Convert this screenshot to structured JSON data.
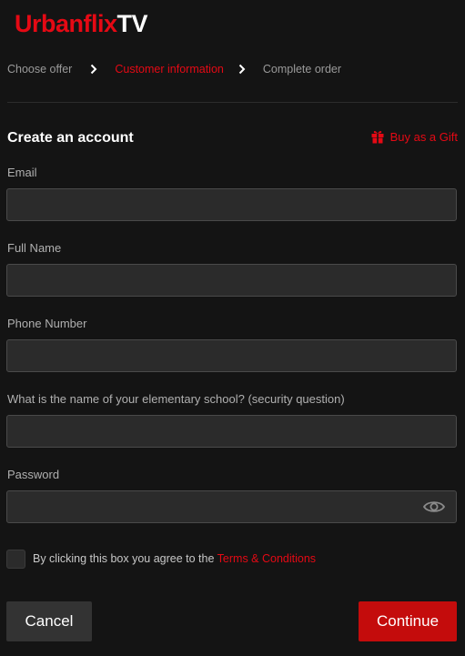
{
  "logo": {
    "brand": "Urbanflix",
    "suffix": "TV"
  },
  "steps": [
    {
      "label": "Choose offer",
      "active": false
    },
    {
      "label": "Customer information",
      "active": true
    },
    {
      "label": "Complete order",
      "active": false
    }
  ],
  "form": {
    "title": "Create an account",
    "gift_label": "Buy as a Gift",
    "fields": {
      "email": {
        "label": "Email",
        "value": "",
        "placeholder": ""
      },
      "full_name": {
        "label": "Full Name",
        "value": "",
        "placeholder": ""
      },
      "phone": {
        "label": "Phone Number",
        "value": "",
        "placeholder": ""
      },
      "security": {
        "label": "What is the name of your elementary school? (security question)",
        "value": "",
        "placeholder": ""
      },
      "password": {
        "label": "Password",
        "value": "",
        "placeholder": ""
      }
    },
    "agree_text": "By clicking this box you agree to the ",
    "terms_link": "Terms & Conditions",
    "cancel_label": "Cancel",
    "continue_label": "Continue"
  },
  "icons": {
    "gift": "gift-icon",
    "chevron": "chevron-right-icon",
    "password_toggle": "eye-icon"
  },
  "colors": {
    "background": "#141414",
    "accent": "#e50914",
    "input_bg": "#2b2b2b",
    "button_primary": "#c40c0c",
    "button_secondary": "#333333"
  }
}
